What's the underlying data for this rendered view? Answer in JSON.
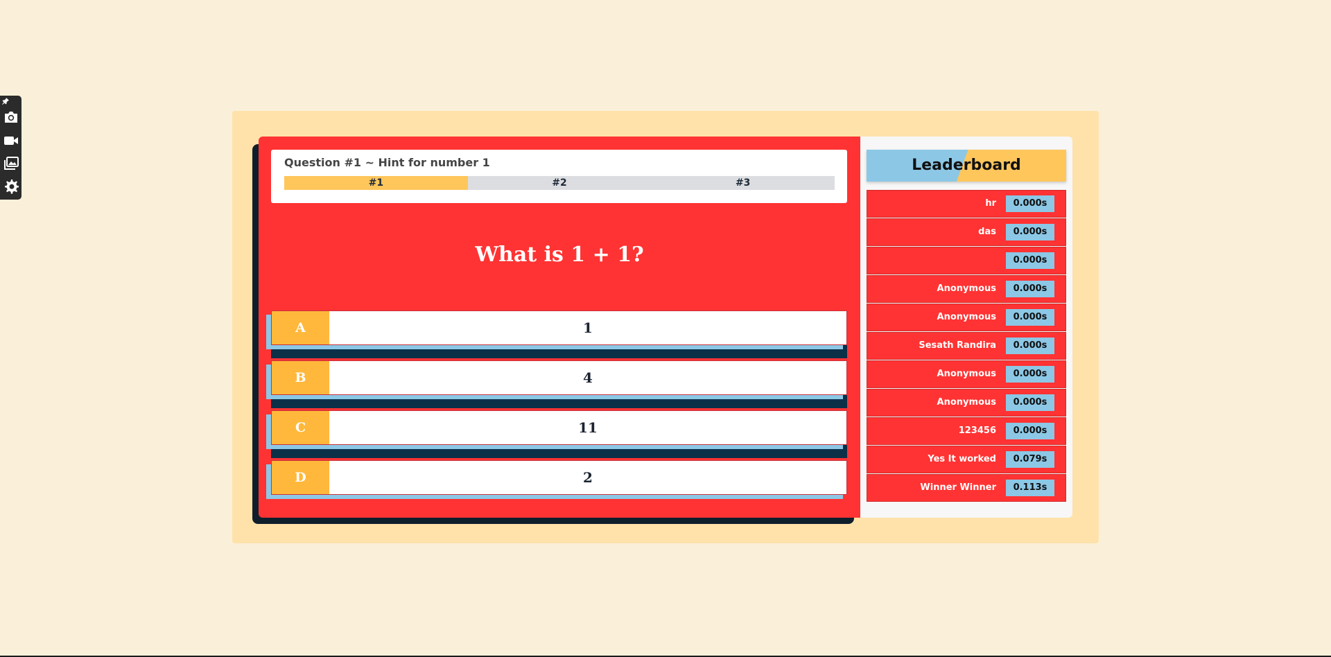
{
  "toolbar": {
    "items": [
      {
        "icon": "pin-icon"
      },
      {
        "icon": "camera-icon"
      },
      {
        "icon": "video-camera-icon"
      },
      {
        "icon": "gallery-icon"
      },
      {
        "icon": "gear-icon"
      }
    ]
  },
  "quiz": {
    "hint_title": "Question #1 ~ Hint for number 1",
    "hint_tabs": [
      "#1",
      "#2",
      "#3"
    ],
    "active_hint": 0,
    "question": "What is 1 + 1?",
    "answers": [
      {
        "letter": "A",
        "text": "1"
      },
      {
        "letter": "B",
        "text": "4"
      },
      {
        "letter": "C",
        "text": "11"
      },
      {
        "letter": "D",
        "text": "2"
      }
    ]
  },
  "leaderboard": {
    "title": "Leaderboard",
    "rows": [
      {
        "name": "hr",
        "time": "0.000s"
      },
      {
        "name": "das",
        "time": "0.000s"
      },
      {
        "name": "",
        "time": "0.000s"
      },
      {
        "name": "Anonymous",
        "time": "0.000s"
      },
      {
        "name": "Anonymous",
        "time": "0.000s"
      },
      {
        "name": "Sesath Randira",
        "time": "0.000s"
      },
      {
        "name": "Anonymous",
        "time": "0.000s"
      },
      {
        "name": "Anonymous",
        "time": "0.000s"
      },
      {
        "name": "123456",
        "time": "0.000s"
      },
      {
        "name": "Yes It worked",
        "time": "0.079s"
      },
      {
        "name": "Winner Winner",
        "time": "0.113s"
      }
    ]
  },
  "colors": {
    "background": "#faf0da",
    "frame": "#fee2aa",
    "game_red": "#ff3333",
    "accent_yellow": "#ffc65c",
    "letter_orange": "#ffb83b",
    "accent_blue": "#8cc8e6",
    "navy": "#0d3049"
  }
}
